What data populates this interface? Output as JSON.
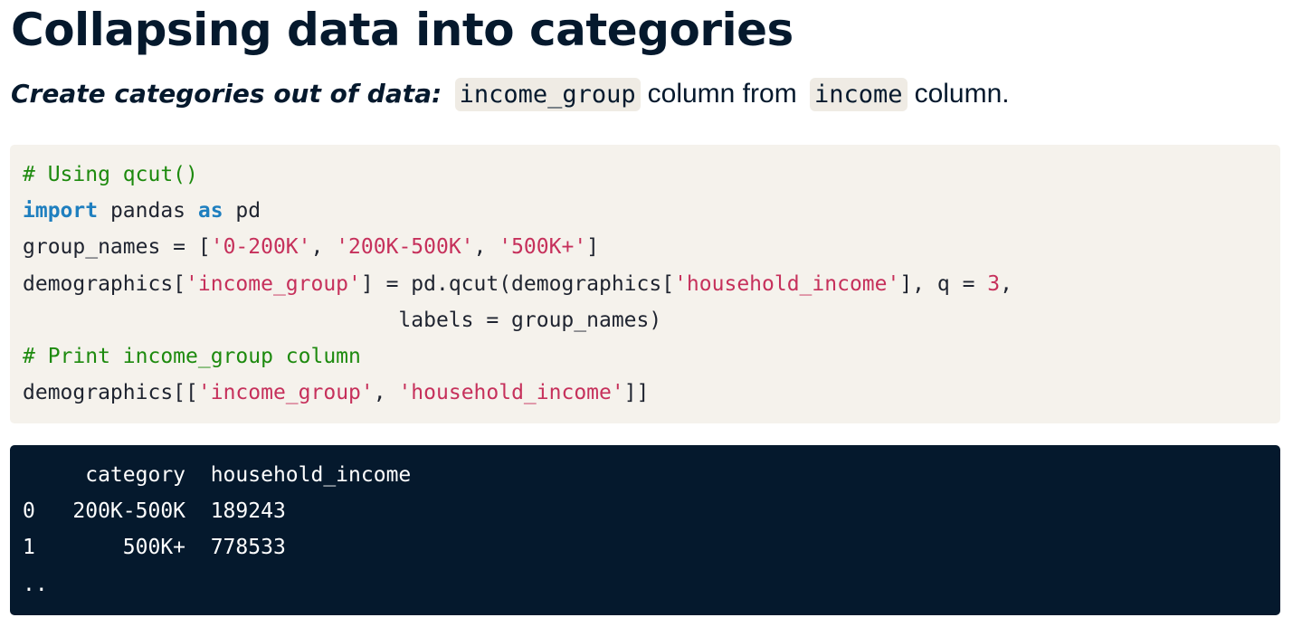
{
  "slide": {
    "title": "Collapsing data into categories",
    "subtitle": {
      "lead": "Create categories out of data:",
      "code1": "income_group",
      "middle": "column from",
      "code2": "income",
      "tail": "column."
    }
  },
  "code": {
    "line1": "# Using qcut()",
    "line2": {
      "kw_import": "import",
      "module": " pandas ",
      "kw_as": "as",
      "alias": " pd"
    },
    "line3": {
      "prefix": "group_names = [",
      "s1": "'0-200K'",
      "sep1": ", ",
      "s2": "'200K-500K'",
      "sep2": ", ",
      "s3": "'500K+'",
      "suffix": "]"
    },
    "line4": {
      "p1": "demographics[",
      "s1": "'income_group'",
      "p2": "] = pd.qcut(demographics[",
      "s2": "'household_income'",
      "p3": "], q = ",
      "num": "3",
      "p4": ","
    },
    "line5": "                              labels = group_names)",
    "line6": "# Print income_group column",
    "line7": {
      "p1": "demographics[[",
      "s1": "'income_group'",
      "sep": ", ",
      "s2": "'household_income'",
      "p2": "]]"
    }
  },
  "output": {
    "header": "     category  household_income",
    "rows": [
      "0   200K-500K  189243",
      "1       500K+  778533"
    ],
    "ellipsis": ".."
  }
}
